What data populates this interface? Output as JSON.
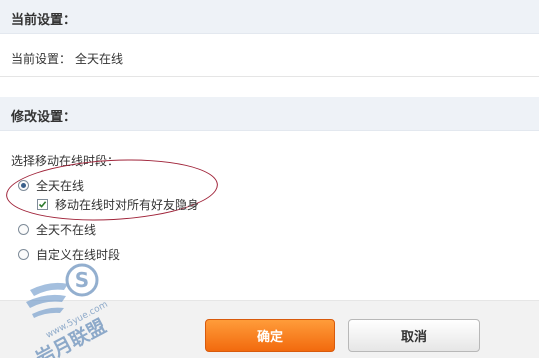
{
  "current_section": {
    "title": "当前设置：",
    "label": "当前设置：",
    "value": "全天在线"
  },
  "modify_section": {
    "title": "修改设置：",
    "prompt": "选择移动在线时段：",
    "options": [
      {
        "label": "全天在线",
        "selected": true
      },
      {
        "label": "全天不在线",
        "selected": false
      },
      {
        "label": "自定义在线时段",
        "selected": false
      }
    ],
    "checkbox": {
      "label": "移动在线时对所有好友隐身",
      "checked": true
    }
  },
  "buttons": {
    "ok": "确定",
    "cancel": "取消"
  },
  "watermark": {
    "badge": "S",
    "text": "岩月联盟",
    "url": "www.5yue.com"
  },
  "colors": {
    "header_bg": "#eef2f7",
    "ok_button": "#f26a0e",
    "highlight_ellipse": "#a0243a",
    "watermark": "#3b6ea8"
  }
}
